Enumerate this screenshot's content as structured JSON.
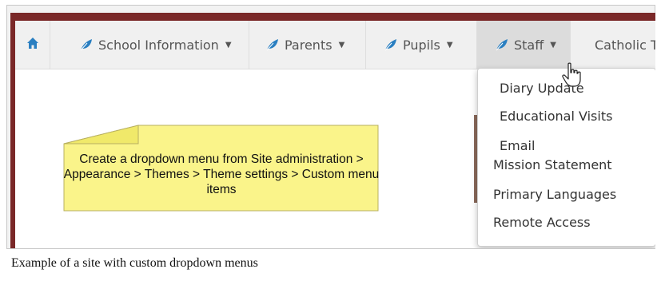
{
  "nav": {
    "home_icon": "home-icon",
    "leaf_icon": "leaf-icon",
    "leaf_color": "#2a7fc1",
    "items": [
      {
        "label": "School Information"
      },
      {
        "label": "Parents"
      },
      {
        "label": "Pupils"
      },
      {
        "label": "Staff",
        "active": true
      },
      {
        "label": "Catholic T"
      }
    ]
  },
  "dropdown": {
    "items": [
      {
        "label": "Diary Update"
      },
      {
        "label": "Educational Visits"
      },
      {
        "label": "Email"
      },
      {
        "label": "Mission Statement"
      },
      {
        "label": "Primary Languages"
      },
      {
        "label": "Remote Access"
      }
    ]
  },
  "note": {
    "text": "Create a dropdown menu from Site administration > Appearance > Themes > Theme settings > Custom menu items",
    "color": "#faf48a"
  },
  "caption": "Example of a site with custom dropdown menus",
  "colors": {
    "frame_border": "#7a2828",
    "navbar_bg": "#f0f0f0",
    "active_bg": "#dcdcdc"
  }
}
